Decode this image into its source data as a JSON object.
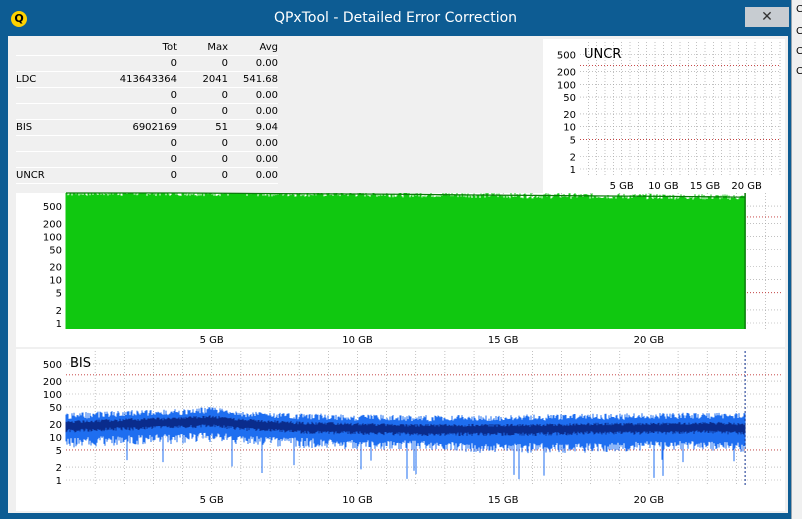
{
  "window": {
    "title": "QPxTool - Detailed Error Correction",
    "close_glyph": "✕",
    "app_icon_glyph": "Q"
  },
  "right_strip": [
    "C",
    "C",
    "C",
    "C"
  ],
  "stats": {
    "headers": {
      "tot": "Tot",
      "max": "Max",
      "avg": "Avg"
    },
    "rows": [
      {
        "label": "",
        "tot": "0",
        "max": "0",
        "avg": "0.00"
      },
      {
        "label": "LDC",
        "tot": "413643364",
        "max": "2041",
        "avg": "541.68"
      },
      {
        "label": "",
        "tot": "0",
        "max": "0",
        "avg": "0.00"
      },
      {
        "label": "",
        "tot": "0",
        "max": "0",
        "avg": "0.00"
      },
      {
        "label": "BIS",
        "tot": "6902169",
        "max": "51",
        "avg": "9.04"
      },
      {
        "label": "",
        "tot": "0",
        "max": "0",
        "avg": "0.00"
      },
      {
        "label": "",
        "tot": "0",
        "max": "0",
        "avg": "0.00"
      },
      {
        "label": "UNCR",
        "tot": "0",
        "max": "0",
        "avg": "0.00"
      }
    ]
  },
  "colors": {
    "ldc": "#10c810",
    "bis_light": "#1e6ef0",
    "bis_dark": "#0a2c8c",
    "threshold": "#c03030",
    "grid": "#9a9a9a"
  },
  "chart_data": [
    {
      "name": "UNCR",
      "type": "area",
      "label": "UNCR",
      "y_scale": "log",
      "y_ticks": [
        "500",
        "200",
        "100",
        "50",
        "20",
        "10",
        "5",
        "2",
        "1"
      ],
      "x_ticks": [
        "5 GB",
        "10 GB",
        "15 GB",
        "20 GB"
      ],
      "xlim": [
        0,
        24
      ],
      "threshold_lines": [
        280,
        5
      ],
      "series": []
    },
    {
      "name": "LDC",
      "type": "area",
      "label": "LDC",
      "y_scale": "log",
      "y_ticks": [
        "500",
        "200",
        "100",
        "50",
        "20",
        "10",
        "5",
        "2",
        "1"
      ],
      "x_ticks": [
        "5 GB",
        "10 GB",
        "15 GB",
        "20 GB"
      ],
      "xlim": [
        0,
        24.6
      ],
      "threshold_lines": [
        280,
        5
      ],
      "series": [
        {
          "x": [
            0,
            2,
            4,
            6,
            8,
            10,
            12,
            14,
            16,
            18,
            20,
            22,
            23.3
          ],
          "y": [
            1000,
            1000,
            1000,
            980,
            960,
            950,
            930,
            900,
            880,
            860,
            840,
            820,
            800
          ]
        }
      ]
    },
    {
      "name": "BIS",
      "type": "area",
      "label": "BIS",
      "y_scale": "log",
      "y_ticks": [
        "500",
        "200",
        "100",
        "50",
        "20",
        "10",
        "5",
        "2",
        "1"
      ],
      "x_ticks": [
        "5 GB",
        "10 GB",
        "15 GB",
        "20 GB"
      ],
      "xlim": [
        0,
        24.6
      ],
      "threshold_lines": [
        280,
        5
      ],
      "series": [
        {
          "name": "upper",
          "x": [
            0,
            2,
            4,
            5,
            6,
            8,
            10,
            12,
            14,
            16,
            18,
            20,
            22,
            23.3
          ],
          "y": [
            30,
            35,
            38,
            42,
            34,
            30,
            28,
            27,
            27,
            28,
            29,
            30,
            31,
            30
          ]
        },
        {
          "name": "core",
          "x": [
            0,
            2,
            4,
            5,
            6,
            8,
            10,
            12,
            14,
            16,
            18,
            20,
            22,
            23.3
          ],
          "y": [
            18,
            20,
            22,
            24,
            20,
            17,
            16,
            15,
            15,
            15,
            16,
            16,
            17,
            16
          ]
        },
        {
          "name": "lower",
          "x": [
            0,
            2,
            4,
            5,
            6,
            8,
            10,
            12,
            14,
            16,
            18,
            20,
            22,
            23.3
          ],
          "y": [
            8,
            9,
            10,
            11,
            9,
            8,
            7,
            7,
            6,
            6,
            6,
            7,
            7,
            6
          ]
        }
      ]
    }
  ]
}
